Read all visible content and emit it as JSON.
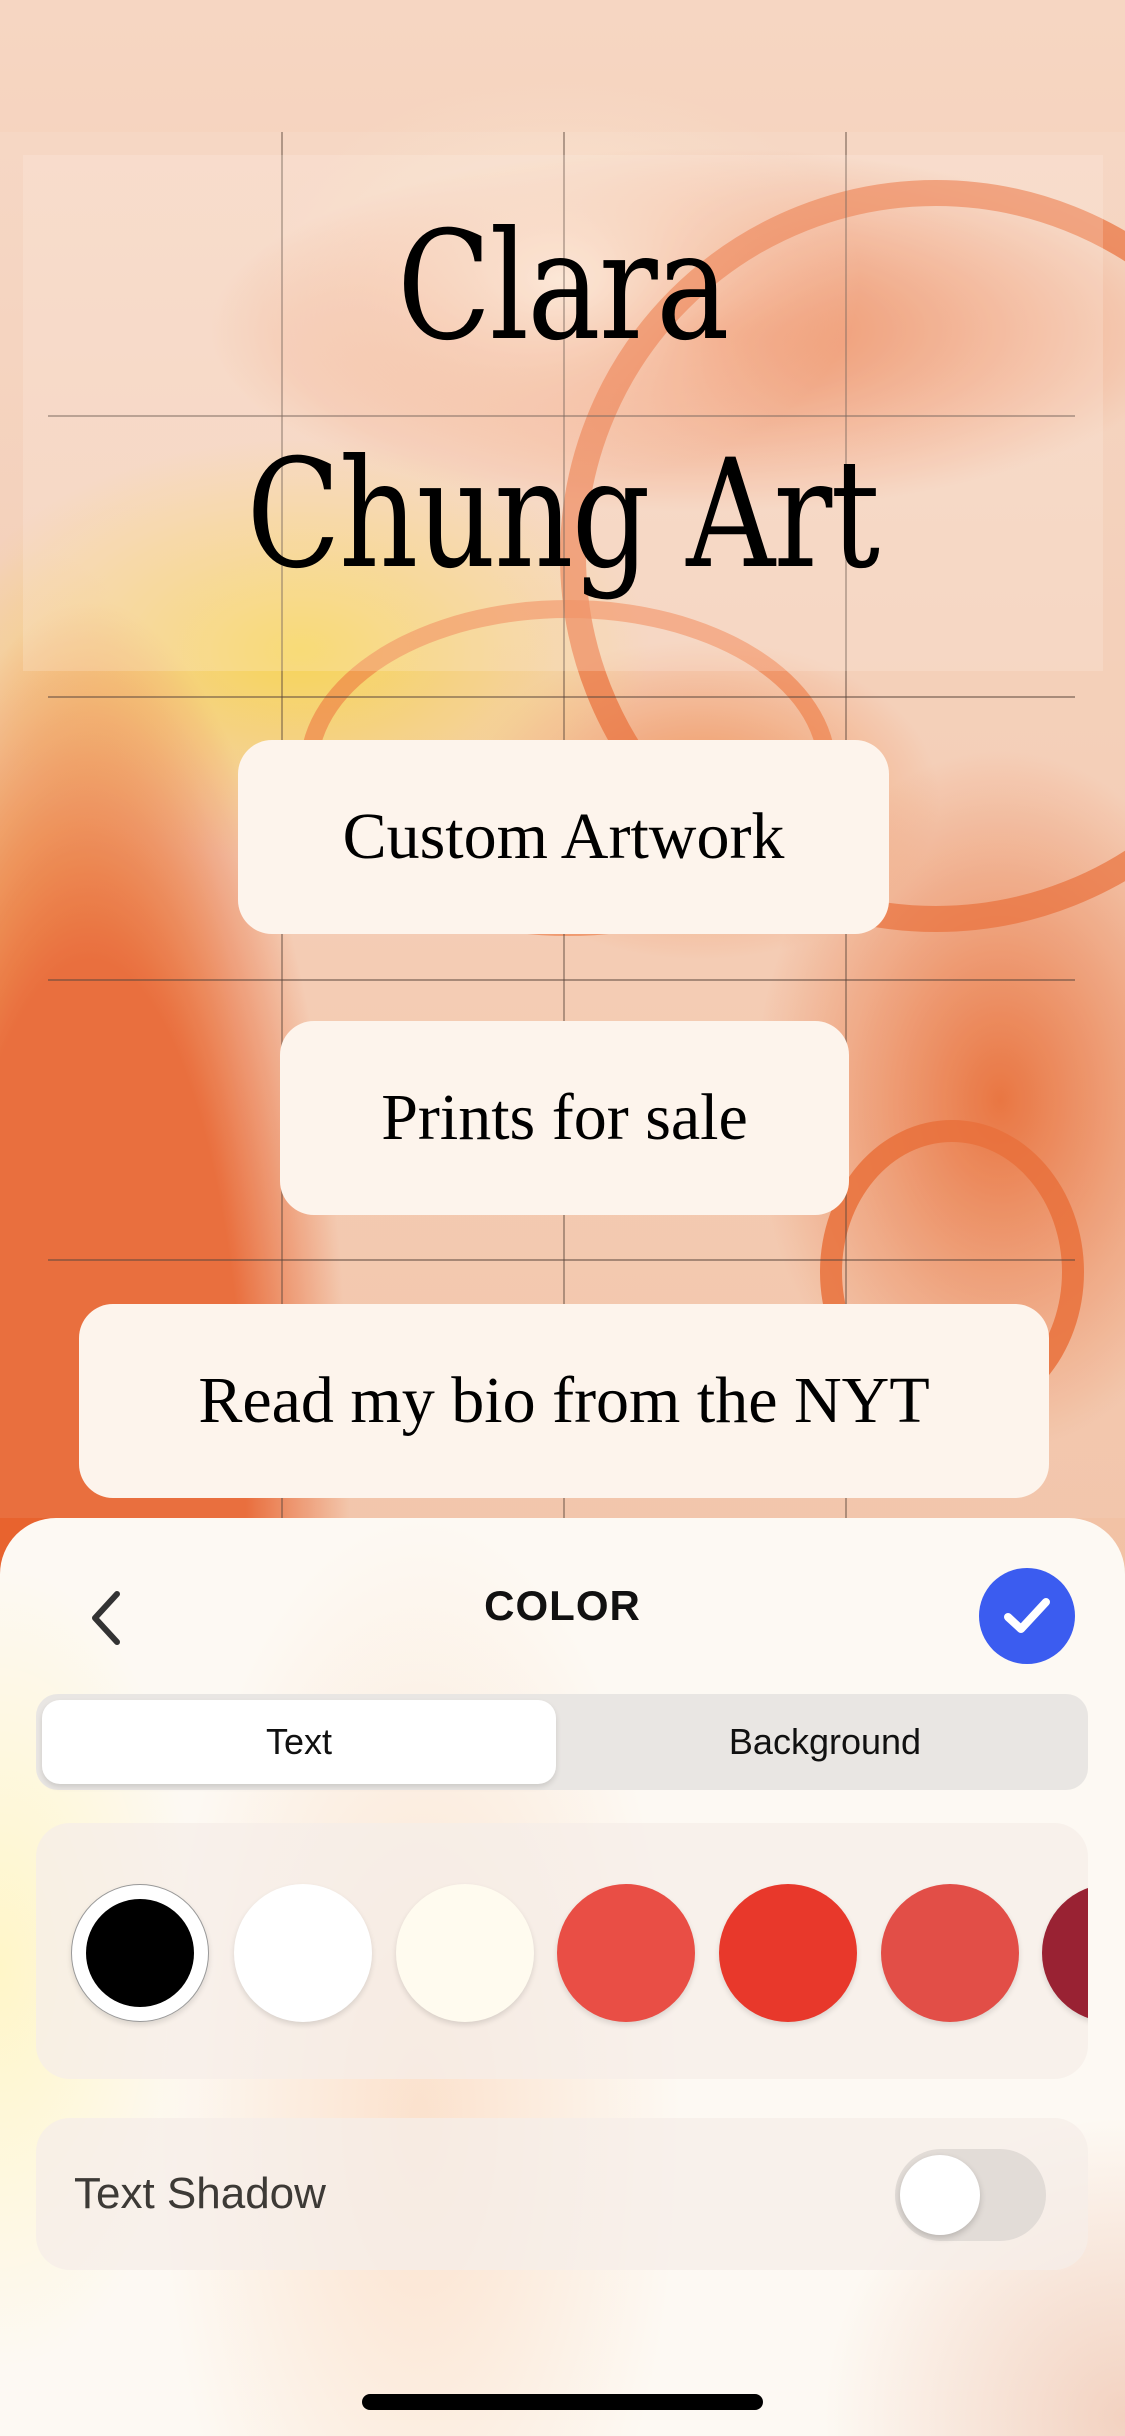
{
  "page": {
    "title_lines": [
      "Clara",
      "Chung Art"
    ],
    "links": [
      {
        "label": "Custom Artwork"
      },
      {
        "label": "Prints for sale"
      },
      {
        "label": "Read my bio from the NYT"
      }
    ]
  },
  "sheet": {
    "title": "COLOR",
    "back_icon": "chevron-left-icon",
    "done_icon": "checkmark-icon",
    "accent_color": "#3b5cf0",
    "tabs": [
      {
        "label": "Text",
        "active": true
      },
      {
        "label": "Background",
        "active": false
      }
    ],
    "swatches": [
      {
        "name": "black",
        "color": "#000000",
        "selected": true
      },
      {
        "name": "white",
        "color": "#ffffff",
        "selected": false
      },
      {
        "name": "ivory",
        "color": "#fffbef",
        "selected": false
      },
      {
        "name": "coral-red",
        "color": "#e94e45",
        "selected": false
      },
      {
        "name": "red",
        "color": "#e8382b",
        "selected": false
      },
      {
        "name": "light-red",
        "color": "#e24e47",
        "selected": false
      },
      {
        "name": "burgundy",
        "color": "#992233",
        "selected": false
      }
    ],
    "text_shadow": {
      "label": "Text Shadow",
      "enabled": false
    }
  }
}
